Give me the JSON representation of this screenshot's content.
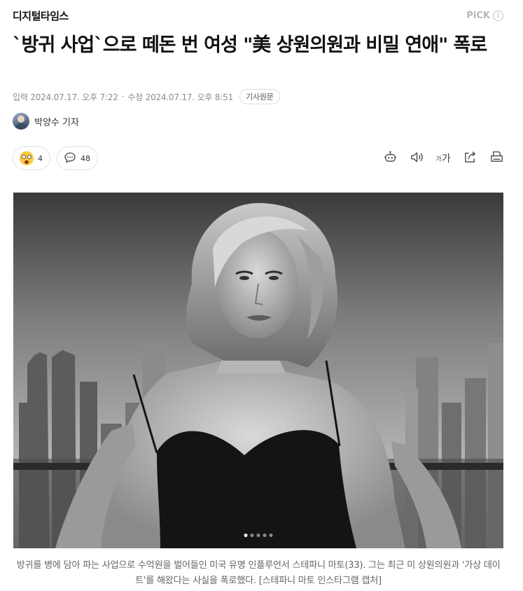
{
  "header": {
    "press_name": "디지털타임스",
    "pick_label": "PiCK",
    "info_glyph": "i"
  },
  "article": {
    "title": "`방귀 사업`으로 떼돈 번 여성 \"美 상원의원과 비밀 연애\" 폭로",
    "input_label": "입력",
    "input_date": "2024.07.17. 오후 7:22",
    "separator": "·",
    "modified_label": "수정",
    "modified_date": "2024.07.17. 오후 8:51",
    "original_button": "기사원문",
    "author": "박양수 기자"
  },
  "reactions": {
    "emoji_count": "4",
    "comment_count": "48"
  },
  "tools": {
    "font_size_small": "가",
    "font_size_large": "가"
  },
  "photo": {
    "slide_count": 5,
    "active_slide": 1,
    "caption": "방귀를 병에 담아 파는 사업으로 수억원을 벌어들인 미국 유명 인플루언서 스테파니 마토(33). 그는 최근 미 상원의원과 '가상 데이트'를 해왔다는 사실을 폭로했다. [스테파니 마토 인스타그램 캡처]"
  }
}
